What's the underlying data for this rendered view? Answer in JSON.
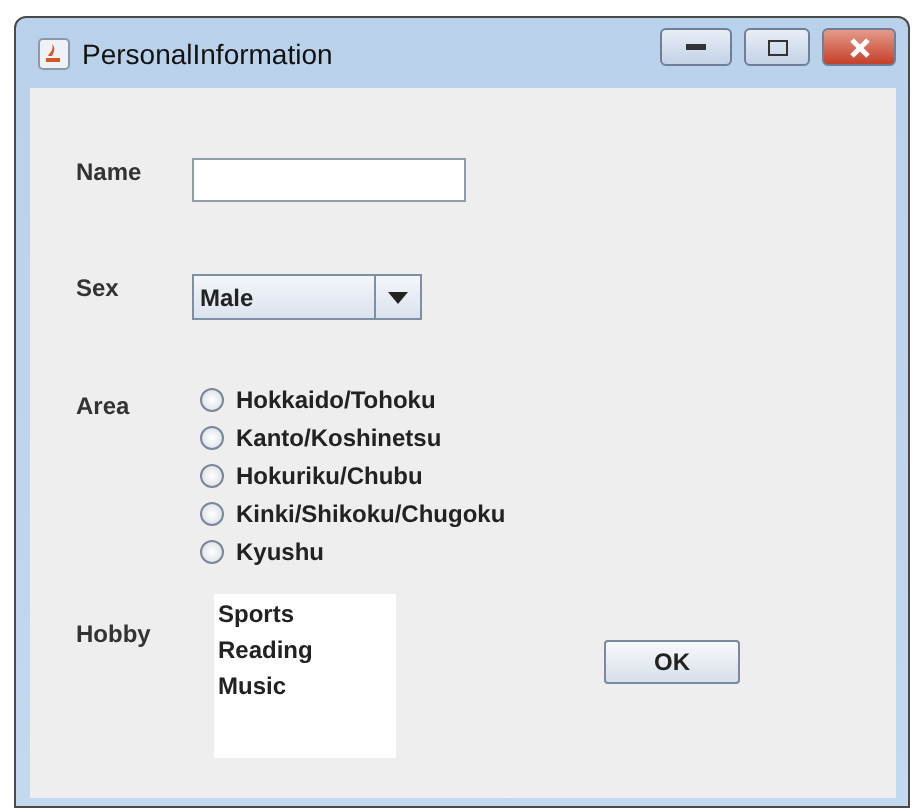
{
  "window": {
    "title": "PersonalInformation"
  },
  "name": {
    "label": "Name"
  },
  "sex": {
    "label": "Sex",
    "value": "Male"
  },
  "area": {
    "label": "Area",
    "options": [
      {
        "label": "Hokkaido/Tohoku",
        "selected": false
      },
      {
        "label": "Kanto/Koshinetsu",
        "selected": false
      },
      {
        "label": "Hokuriku/Chubu",
        "selected": false
      },
      {
        "label": "Kinki/Shikoku/Chugoku",
        "selected": false
      },
      {
        "label": "Kyushu",
        "selected": false
      }
    ]
  },
  "hobby": {
    "label": "Hobby",
    "items": [
      "Sports",
      "Reading",
      "Music"
    ]
  },
  "buttons": [
    "OK"
  ]
}
